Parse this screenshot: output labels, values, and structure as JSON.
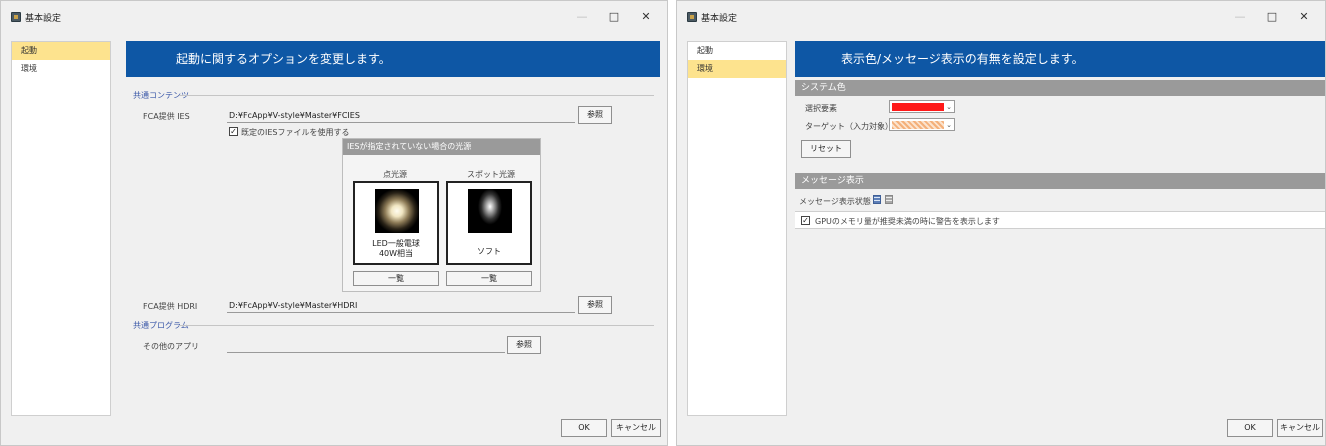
{
  "left_window": {
    "title": "基本設定",
    "controls": {
      "minimize": "—",
      "maximize": "□",
      "close": "✕"
    },
    "sidebar": {
      "items": [
        {
          "label": "起動",
          "active": true
        },
        {
          "label": "環境",
          "active": false
        }
      ]
    },
    "banner": "起動に関するオプションを変更します。",
    "common_contents": {
      "group_label": "共通コンテンツ",
      "ies_label": "FCA提供 IES",
      "ies_path": "D:¥FcApp¥V-style¥Master¥FCIES",
      "ies_browse": "参照",
      "use_default_ies": {
        "label": "既定のIESファイルを使用する",
        "checked": true,
        "mark": "✓"
      },
      "panel": {
        "header": "IESが指定されていない場合の光源",
        "point": {
          "heading": "点光源",
          "caption_line1": "LED一般電球",
          "caption_line2": "40W相当",
          "list_button": "一覧"
        },
        "spot": {
          "heading": "スポット光源",
          "caption": "ソフト",
          "list_button": "一覧"
        }
      },
      "hdri_label": "FCA提供 HDRI",
      "hdri_path": "D:¥FcApp¥V-style¥Master¥HDRI",
      "hdri_browse": "参照"
    },
    "common_program": {
      "group_label": "共通プログラム",
      "other_app_label": "その他のアプリ",
      "other_app_path": "",
      "browse": "参照"
    },
    "ok": "OK",
    "cancel": "キャンセル"
  },
  "right_window": {
    "title": "基本設定",
    "controls": {
      "minimize": "—",
      "maximize": "□",
      "close": "✕"
    },
    "sidebar": {
      "items": [
        {
          "label": "起動",
          "active": false
        },
        {
          "label": "環境",
          "active": true
        }
      ]
    },
    "banner": "表示色/メッセージ表示の有無を設定します。",
    "system_color": {
      "header": "システム色",
      "selected_label": "選択要素",
      "selected_color": "#ff1a1a",
      "target_label": "ターゲット（入力対象）",
      "target_color": "#f4b07a",
      "dropdown_arrow": "⌄",
      "reset": "リセット"
    },
    "message_display": {
      "header": "メッセージ表示",
      "state_label": "メッセージ表示状態",
      "gpu_warning": {
        "label": "GPUのメモリ量が推奨未満の時に警告を表示します",
        "checked": true,
        "mark": "✓"
      }
    },
    "ok": "OK",
    "cancel": "キャンセル"
  },
  "colors": {
    "banner": "#0e57a5",
    "sidebar_active": "#fde38e",
    "section_header": "#9a9a9a",
    "group_label": "#3a57a8"
  }
}
